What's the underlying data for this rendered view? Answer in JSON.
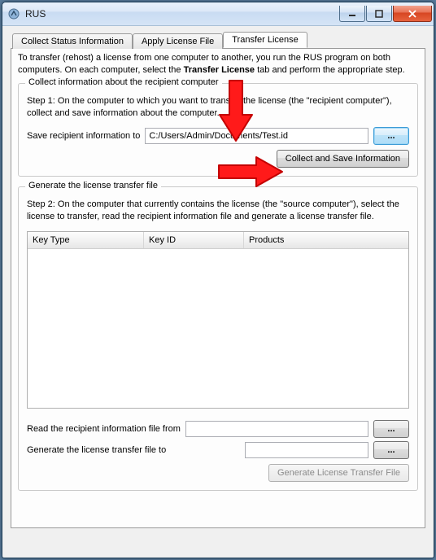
{
  "window": {
    "title": "RUS"
  },
  "tabs": {
    "status": "Collect Status Information",
    "apply": "Apply License File",
    "transfer": "Transfer License"
  },
  "intro": {
    "pre": "To transfer (rehost) a license from one computer to another, you run the RUS program on both computers. On each computer, select the ",
    "bold": "Transfer License",
    "post": " tab and perform the appropriate step."
  },
  "group1": {
    "title": "Collect information about the recipient computer",
    "step": "Step 1: On the computer to which you want to transfer the license (the \"recipient computer\"), collect and save information about the computer.",
    "save_label": "Save recipient information to",
    "path_value": "C:/Users/Admin/Documents/Test.id",
    "browse": "...",
    "collect_btn": "Collect and Save Information"
  },
  "group2": {
    "title": "Generate the license transfer file",
    "step": "Step 2: On the computer that currently contains the license (the \"source computer\"), select the license to transfer, read the recipient information file and generate a license transfer file.",
    "columns": {
      "c1": "Key Type",
      "c2": "Key ID",
      "c3": "Products"
    },
    "read_label": "Read the recipient information file from",
    "gen_label": "Generate the license transfer file to",
    "browse": "...",
    "gen_btn": "Generate License Transfer File"
  }
}
